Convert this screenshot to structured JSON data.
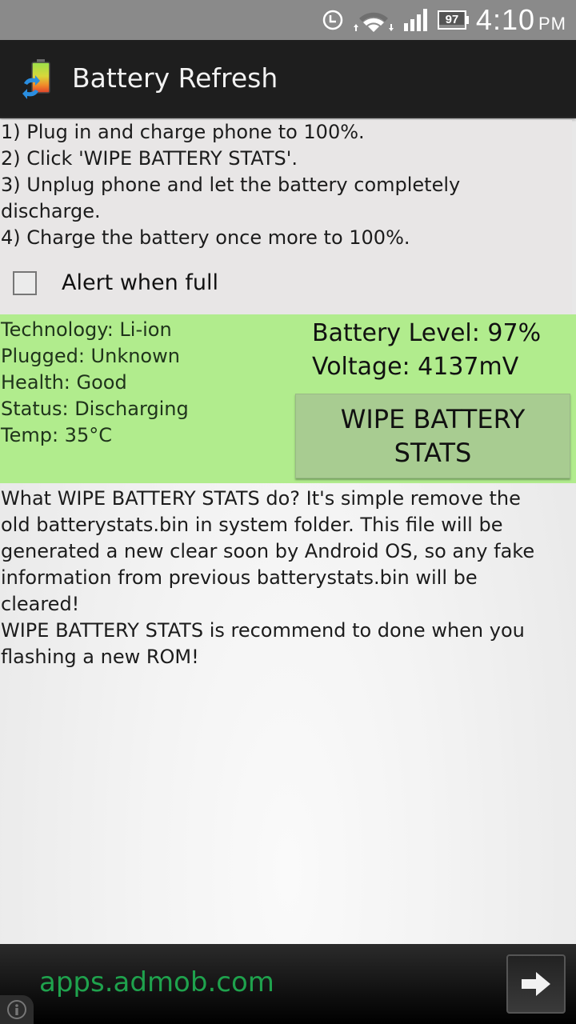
{
  "status_bar": {
    "battery_percent": "97",
    "time": "4:10",
    "ampm": "PM",
    "icons": [
      "alarm-clock-icon",
      "wifi-icon",
      "signal-icon",
      "battery-icon"
    ]
  },
  "action_bar": {
    "title": "Battery Refresh",
    "icon": "battery-refresh-app-icon"
  },
  "instructions": [
    "1) Plug in and charge phone to 100%.",
    "2) Click 'WIPE BATTERY STATS'.",
    "3) Unplug phone and let the battery completely",
    "discharge.",
    "4) Charge the battery once more to 100%."
  ],
  "alert_checkbox": {
    "label": "Alert when full",
    "checked": false
  },
  "battery_info": {
    "technology": "Technology: Li-ion",
    "plugged": "Plugged: Unknown",
    "health": "Health: Good",
    "status": "Status: Discharging",
    "temp": "Temp: 35°C",
    "level": "Battery Level: 97%",
    "voltage": "Voltage: 4137mV"
  },
  "wipe_button": {
    "line1": "WIPE BATTERY",
    "line2": "STATS"
  },
  "description": [
    "What WIPE BATTERY STATS do? It's simple remove the",
    "old batterystats.bin in system folder. This file will be",
    "generated a new clear soon by Android OS, so any fake",
    "information from previous batterystats.bin will be",
    "cleared!",
    "WIPE BATTERY STATS is recommend to done when you",
    "flashing a new ROM!"
  ],
  "ad_banner": {
    "text": "apps.admob.com",
    "arrow_icon": "arrow-right-icon",
    "info_icon": "info-icon"
  },
  "colors": {
    "panel_green": "#b1ec8d",
    "button_green": "#a8cc91",
    "ad_text_green": "#1fa24d",
    "status_bar_gray": "#8a8a8a",
    "action_bar_dark": "#1e1e1e"
  }
}
